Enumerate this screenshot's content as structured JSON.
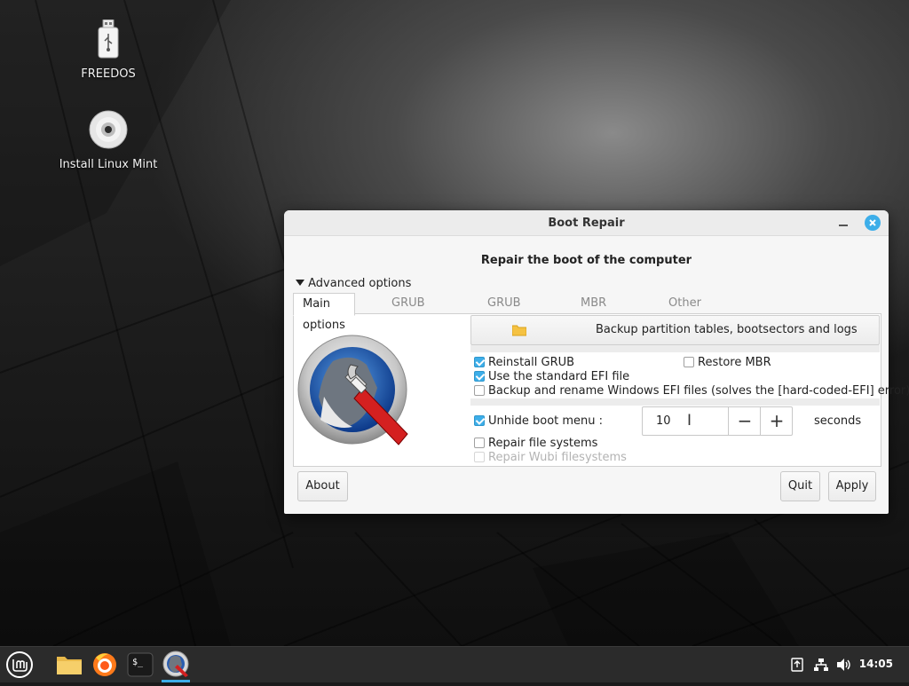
{
  "desktop": {
    "icons": [
      {
        "label": "FREEDOS",
        "icon": "usb-drive-icon"
      },
      {
        "label": "Install Linux Mint",
        "icon": "optical-disc-icon"
      }
    ]
  },
  "window": {
    "title": "Boot Repair",
    "heading": "Repair the boot of the computer",
    "expander_label": "Advanced options",
    "tabs": [
      {
        "label": "Main options",
        "active": true
      },
      {
        "label": "GRUB location",
        "active": false
      },
      {
        "label": "GRUB options",
        "active": false
      },
      {
        "label": "MBR options",
        "active": false
      },
      {
        "label": "Other options",
        "active": false
      }
    ],
    "backup_button": "Backup partition tables, bootsectors and logs",
    "options": {
      "reinstall_grub": {
        "label": "Reinstall GRUB",
        "checked": true
      },
      "restore_mbr": {
        "label": "Restore MBR",
        "checked": false
      },
      "standard_efi": {
        "label": "Use the standard EFI file",
        "checked": true
      },
      "backup_rename_efi": {
        "label": "Backup and rename Windows EFI files (solves the [hard-coded-EFI] error)",
        "checked": false
      },
      "unhide_boot_menu": {
        "label": "Unhide boot menu :",
        "checked": true
      },
      "repair_fs": {
        "label": "Repair file systems",
        "checked": false
      },
      "repair_wubi": {
        "label": "Repair Wubi filesystems",
        "checked": false,
        "disabled": true
      }
    },
    "boot_menu_seconds": {
      "value": "10",
      "minus": "−",
      "plus": "+",
      "unit": "seconds"
    },
    "buttons": {
      "about": "About",
      "quit": "Quit",
      "apply": "Apply"
    },
    "accent_color": "#3daee9"
  },
  "taskbar": {
    "items": [
      "mint-menu-icon",
      "files-icon",
      "firefox-icon",
      "terminal-icon",
      "boot-repair-icon"
    ],
    "active_item": "boot-repair-icon",
    "tray": [
      "update-manager-icon",
      "network-icon",
      "volume-icon"
    ],
    "clock": "14:05"
  }
}
